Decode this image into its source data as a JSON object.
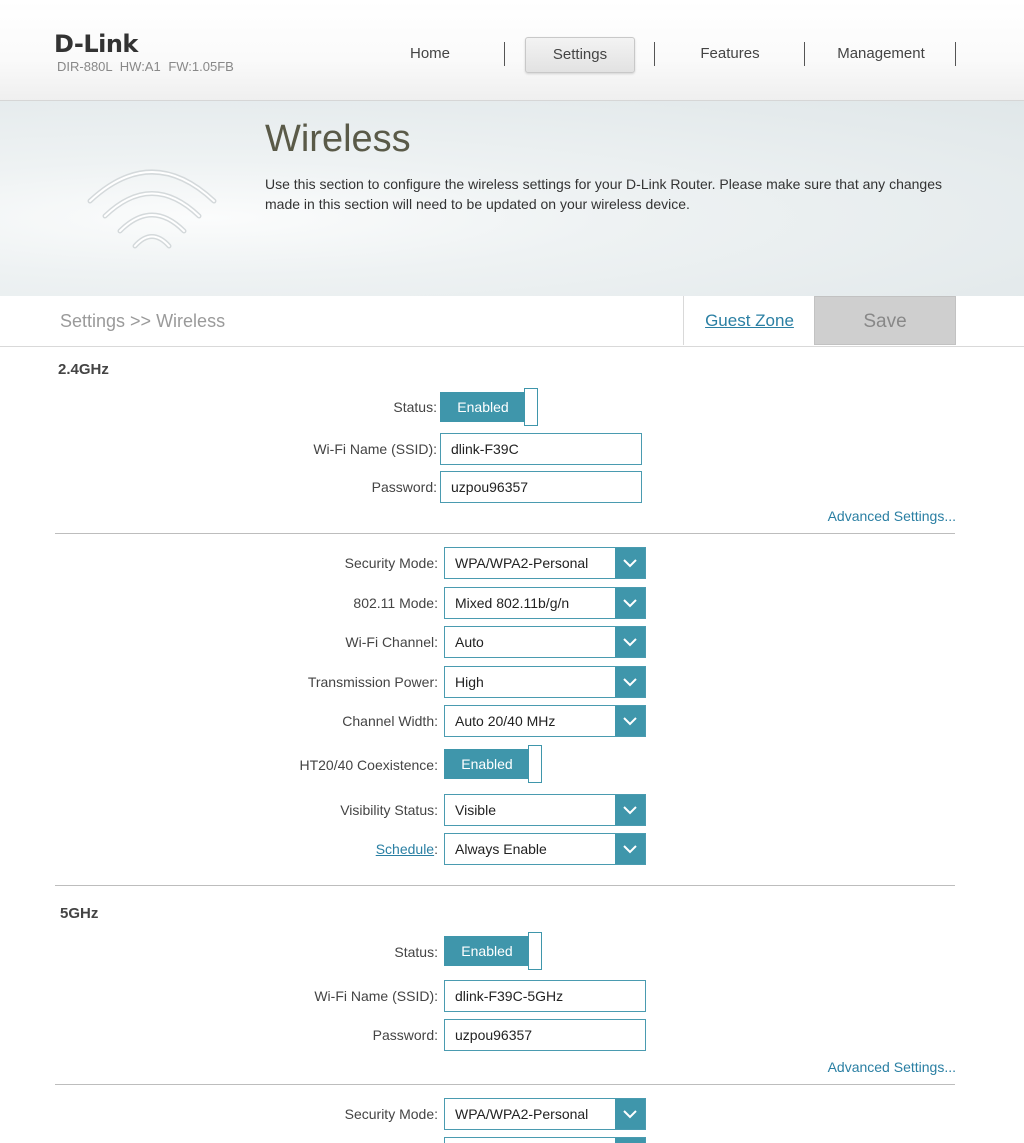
{
  "header": {
    "logo": "D-Link",
    "model_info": "DIR-880L   HW:A1   FW:1.05FB",
    "nav": [
      "Home",
      "Settings",
      "Features",
      "Management"
    ],
    "active_nav": "Settings"
  },
  "banner": {
    "title": "Wireless",
    "description": "Use this section to configure the wireless settings for your D-Link Router. Please make sure that any changes made in this section will need to be updated on your wireless device.",
    "icon": "wifi-icon"
  },
  "toolbar": {
    "breadcrumb": "Settings >> Wireless",
    "guest_zone": "Guest Zone",
    "save": "Save"
  },
  "band24": {
    "title": "2.4GHz",
    "status_label": "Status:",
    "status_value": "Enabled",
    "ssid_label": "Wi-Fi Name (SSID):",
    "ssid_value": "dlink-F39C",
    "password_label": "Password:",
    "password_value": "uzpou96357",
    "advanced": "Advanced Settings...",
    "security_label": "Security Mode:",
    "security_value": "WPA/WPA2-Personal",
    "mode_label": "802.11 Mode:",
    "mode_value": "Mixed 802.11b/g/n",
    "channel_label": "Wi-Fi Channel:",
    "channel_value": "Auto",
    "power_label": "Transmission Power:",
    "power_value": "High",
    "width_label": "Channel Width:",
    "width_value": "Auto 20/40 MHz",
    "coex_label": "HT20/40 Coexistence:",
    "coex_value": "Enabled",
    "visibility_label": "Visibility Status:",
    "visibility_value": "Visible",
    "schedule_label": "Schedule",
    "schedule_colon": ":",
    "schedule_value": "Always Enable"
  },
  "band5": {
    "title": "5GHz",
    "status_label": "Status:",
    "status_value": "Enabled",
    "ssid_label": "Wi-Fi Name (SSID):",
    "ssid_value": "dlink-F39C-5GHz",
    "password_label": "Password:",
    "password_value": "uzpou96357",
    "advanced": "Advanced Settings...",
    "security_label": "Security Mode:",
    "security_value": "WPA/WPA2-Personal"
  },
  "colors": {
    "accent": "#3f96ab",
    "link": "#2a7fa3",
    "save_bg": "#cfcfcf"
  }
}
